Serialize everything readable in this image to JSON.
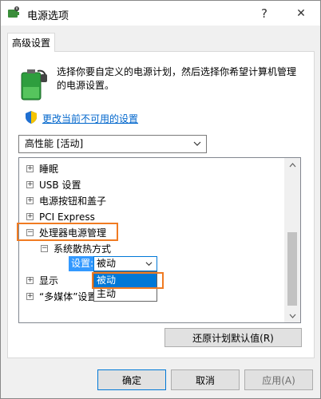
{
  "window": {
    "title": "电源选项",
    "help_glyph": "?",
    "close_glyph": "✕"
  },
  "tab": {
    "label": "高级设置"
  },
  "intro": {
    "line1": "选择你要自定义的电源计划，然后选择你希望计算机管理",
    "line2": "的电源设置。"
  },
  "change_link": "更改当前不可用的设置",
  "plan_select": {
    "value": "高性能 [活动]"
  },
  "tree": {
    "items": [
      {
        "expander": "+",
        "label": "睡眠"
      },
      {
        "expander": "+",
        "label": "USB 设置"
      },
      {
        "expander": "+",
        "label": "电源按钮和盖子"
      },
      {
        "expander": "+",
        "label": "PCI Express"
      },
      {
        "expander": "−",
        "label": "处理器电源管理"
      },
      {
        "expander": "−",
        "label": "系统散热方式"
      },
      {
        "expander": "+",
        "label": "显示"
      },
      {
        "expander": "+",
        "label": "“多媒体”设置"
      }
    ],
    "setting": {
      "label": "设置:",
      "value": "被动",
      "options": [
        "被动",
        "主动"
      ]
    }
  },
  "buttons": {
    "restore": "还原计划默认值(R)",
    "ok": "确定",
    "cancel": "取消",
    "apply": "应用(A)"
  },
  "colors": {
    "accent": "#0078d7",
    "highlight": "#f07b22",
    "link": "#0066cc"
  }
}
